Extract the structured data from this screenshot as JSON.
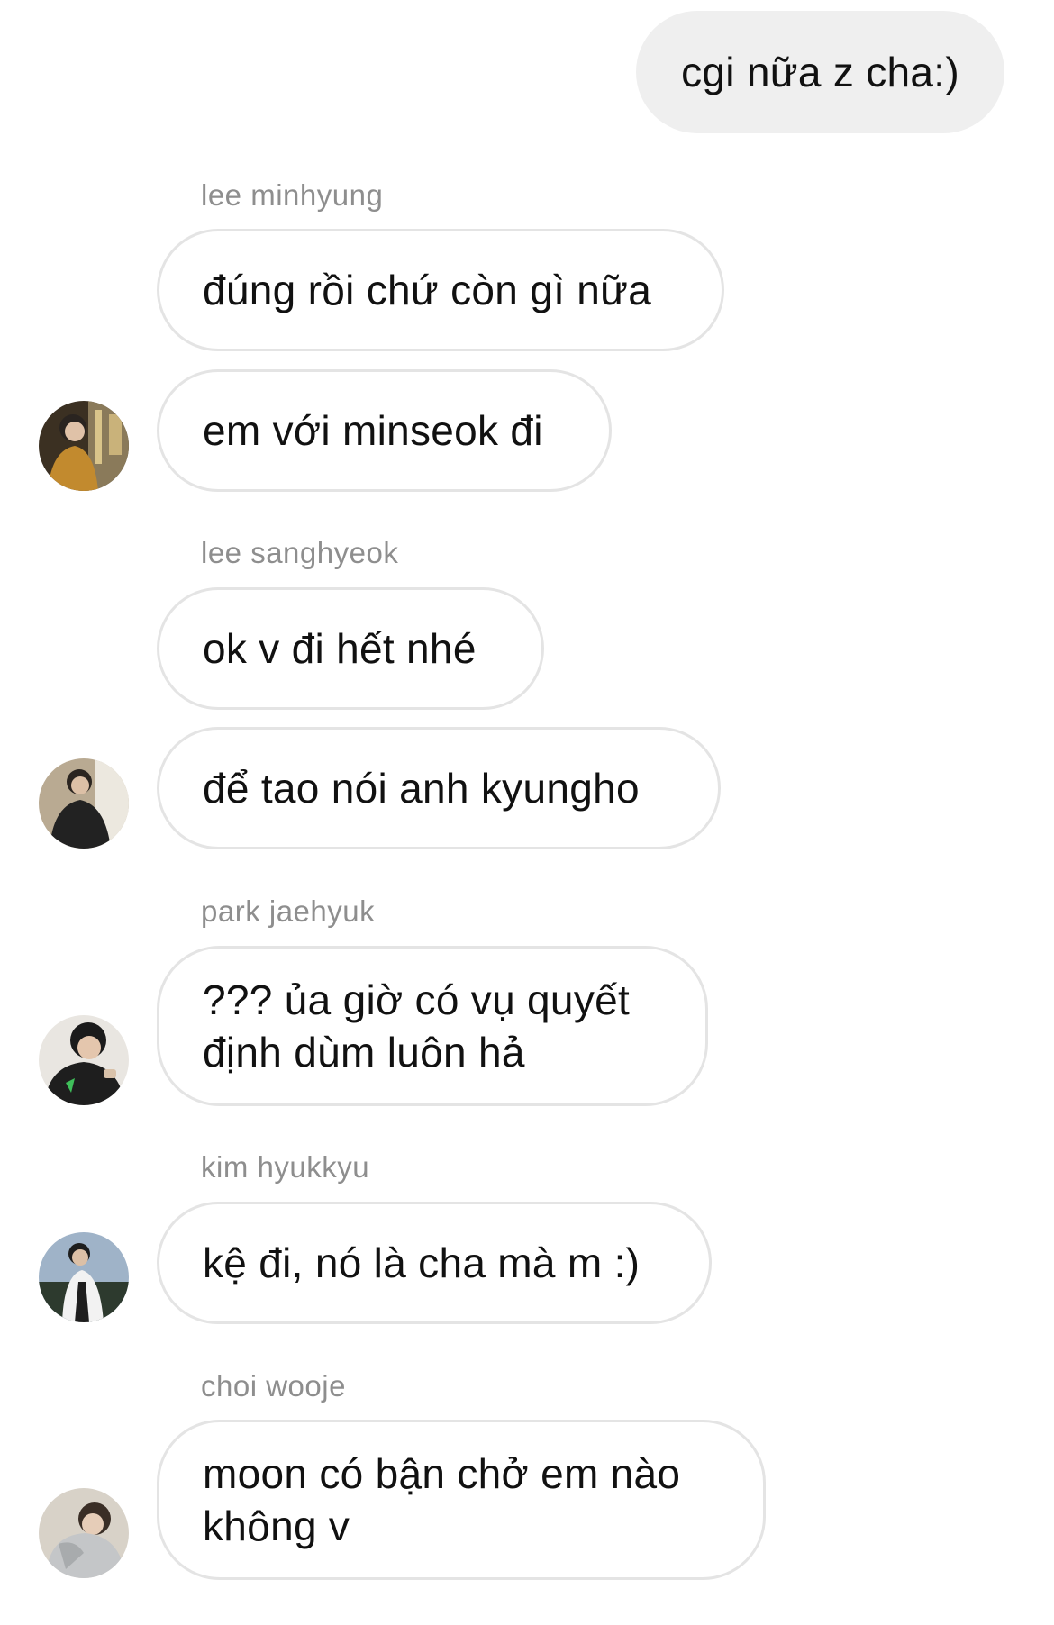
{
  "outgoing": {
    "text": "cgi nữa z cha:)"
  },
  "groups": [
    {
      "sender": "lee minhyung",
      "messages": [
        "đúng rồi chứ còn gì nữa",
        "em với minseok đi"
      ],
      "avatar_icon": "user-avatar-icon"
    },
    {
      "sender": "lee sanghyeok",
      "messages": [
        "ok v đi hết nhé",
        "để tao nói anh kyungho"
      ],
      "avatar_icon": "user-avatar-icon"
    },
    {
      "sender": "park jaehyuk",
      "messages": [
        "??? ủa giờ có vụ quyết định dùm luôn hả"
      ],
      "avatar_icon": "user-avatar-icon"
    },
    {
      "sender": "kim hyukkyu",
      "messages": [
        "kệ đi, nó là cha mà m :)"
      ],
      "avatar_icon": "user-avatar-icon"
    },
    {
      "sender": "choi wooje",
      "messages": [
        "moon có bận chở em nào không v"
      ],
      "avatar_icon": "user-avatar-icon"
    }
  ],
  "colors": {
    "outgoing_bubble": "#efefef",
    "incoming_border": "#e4e4e4",
    "sender_text": "#8e8e8e"
  }
}
